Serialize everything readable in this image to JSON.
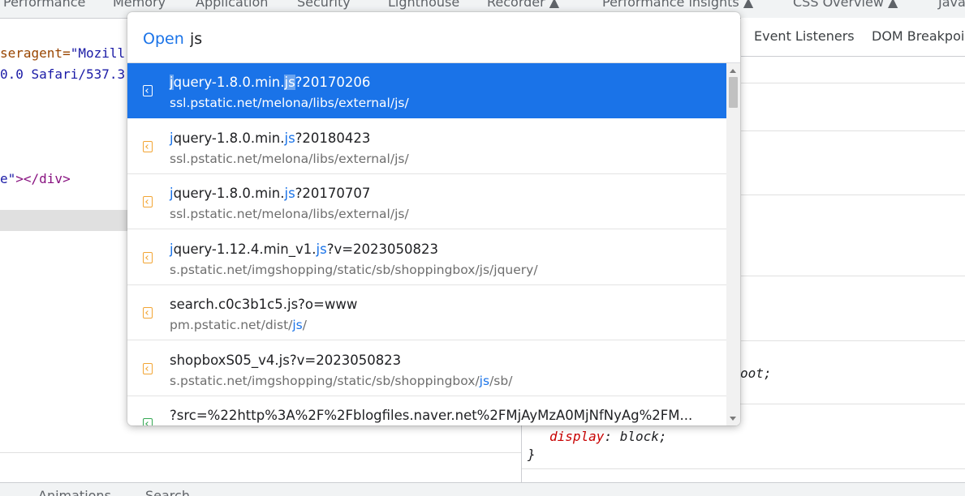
{
  "devtools_tabs": [
    {
      "label": "Performance"
    },
    {
      "label": "Memory"
    },
    {
      "label": "Application"
    },
    {
      "label": "Security"
    },
    {
      "label": "Lighthouse"
    },
    {
      "label": "Recorder ▲"
    },
    {
      "label": "Performance insights ▲"
    },
    {
      "label": "CSS Overview ▲"
    },
    {
      "label": "Java"
    }
  ],
  "styles_tabs": [
    "Event Listeners",
    "DOM Breakpoi"
  ],
  "elements_code": {
    "line1_attr": "seragent=",
    "line1_val": "\"Mozill",
    "line2": "0.0 Safari/537.3",
    "line3_val": "e\"",
    "line3_tag": "></div>"
  },
  "styles_code": {
    "partial": "oot;",
    "prop": "display",
    "colon": ":",
    "value": "block;",
    "brace": "}"
  },
  "bottom_tabs": [
    "Animations",
    "Search"
  ],
  "open_dialog": {
    "prompt": "Open",
    "query": "js",
    "results": [
      {
        "title_pre": "",
        "title_m1": "j",
        "title_mid": "query-1.8.0.min.",
        "title_m2": "js",
        "title_post": "?20170206",
        "path_pre": "ssl.pstatic.net/melona/libs/external/js/",
        "path_hl": "",
        "path_post": "",
        "selected": true
      },
      {
        "title_pre": "",
        "title_m1": "j",
        "title_mid": "query-1.8.0.min.",
        "title_m2": "js",
        "title_post": "?20180423",
        "path_pre": "ssl.pstatic.net/melona/libs/external/js/",
        "path_hl": "",
        "path_post": "",
        "selected": false
      },
      {
        "title_pre": "",
        "title_m1": "j",
        "title_mid": "query-1.8.0.min.",
        "title_m2": "js",
        "title_post": "?20170707",
        "path_pre": "ssl.pstatic.net/melona/libs/external/js/",
        "path_hl": "",
        "path_post": "",
        "selected": false
      },
      {
        "title_pre": "",
        "title_m1": "j",
        "title_mid": "query-1.12.4.min_v1.",
        "title_m2": "js",
        "title_post": "?v=2023050823",
        "path_pre": "s.pstatic.net/imgshopping/static/sb/shoppingbox/js/jquery/",
        "path_hl": "",
        "path_post": "",
        "selected": false
      },
      {
        "title_pre": "search.c0c3b1c5.js?o=www",
        "title_m1": "",
        "title_mid": "",
        "title_m2": "",
        "title_post": "",
        "path_pre": "pm.pstatic.net/dist/",
        "path_hl": "js",
        "path_post": "/",
        "selected": false
      },
      {
        "title_pre": "shopboxS05_v4.js?v=2023050823",
        "title_m1": "",
        "title_mid": "",
        "title_m2": "",
        "title_post": "",
        "path_pre": "s.pstatic.net/imgshopping/static/sb/shoppingbox/",
        "path_hl": "js",
        "path_post": "/sb/",
        "selected": false
      },
      {
        "title_pre": "?src=%22http%3A%2F%2Fblogfiles.naver.net%2FMjAyMzA0MjNfNyAg%2FM...",
        "title_m1": "",
        "title_mid": "",
        "title_m2": "",
        "title_post": "",
        "path_pre": "",
        "path_hl": "",
        "path_post": "",
        "selected": false
      }
    ]
  }
}
